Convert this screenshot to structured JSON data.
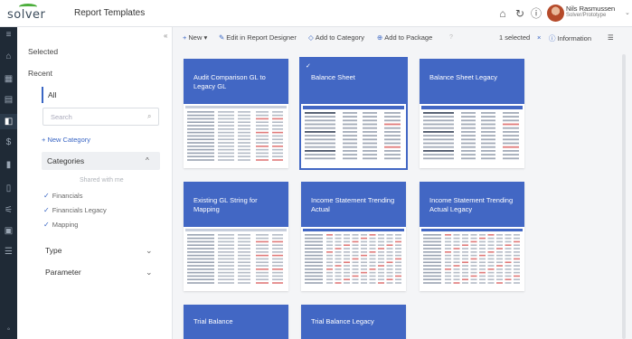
{
  "app": {
    "logo_text": "solver",
    "title": "Report Templates"
  },
  "user": {
    "name": "Nils Rasmussen",
    "org": "Solver/Prototype"
  },
  "topbar_icons": [
    "home-icon",
    "refresh-icon",
    "help-icon"
  ],
  "rail": {
    "icons": [
      "menu-icon",
      "home-icon",
      "grid-icon",
      "table-icon",
      "chart-icon",
      "dollar-icon",
      "building-icon",
      "document-icon",
      "sliders-icon",
      "report-icon",
      "list-icon",
      "settings-icon"
    ]
  },
  "filters": {
    "selected_label": "Selected",
    "recent_label": "Recent",
    "all_label": "All",
    "search_placeholder": "Search",
    "new_category_label": "+ New Category",
    "categories_label": "Categories",
    "shared_label": "Shared with me",
    "category_items": [
      "Financials",
      "Financials Legacy",
      "Mapping"
    ],
    "type_label": "Type",
    "parameter_label": "Parameter"
  },
  "toolbar": {
    "new_label": "New",
    "edit_label": "Edit in Report Designer",
    "add_category_label": "Add to Category",
    "add_package_label": "Add to Package",
    "selected_count": "1 selected",
    "information_label": "Information"
  },
  "cards": [
    {
      "title": "Audit Comparison GL to Legacy GL",
      "selected": false,
      "thumb": "ledger"
    },
    {
      "title": "Balance Sheet",
      "selected": true,
      "thumb": "statement"
    },
    {
      "title": "Balance Sheet Legacy",
      "selected": false,
      "thumb": "statement"
    },
    {
      "title": "Existing GL String for Mapping",
      "selected": false,
      "thumb": "ledger"
    },
    {
      "title": "Income Statement Trending Actual",
      "selected": false,
      "thumb": "trend"
    },
    {
      "title": "Income Statement Trending Actual Legacy",
      "selected": false,
      "thumb": "trend"
    },
    {
      "title": "Trial Balance",
      "selected": false,
      "thumb": "none"
    },
    {
      "title": "Trial Balance Legacy",
      "selected": false,
      "thumb": "none"
    }
  ],
  "colors": {
    "card_header": "#4267c4",
    "accent": "#3a66c4",
    "rail_bg": "#1f2a36",
    "logo_green": "#4cae3c"
  }
}
